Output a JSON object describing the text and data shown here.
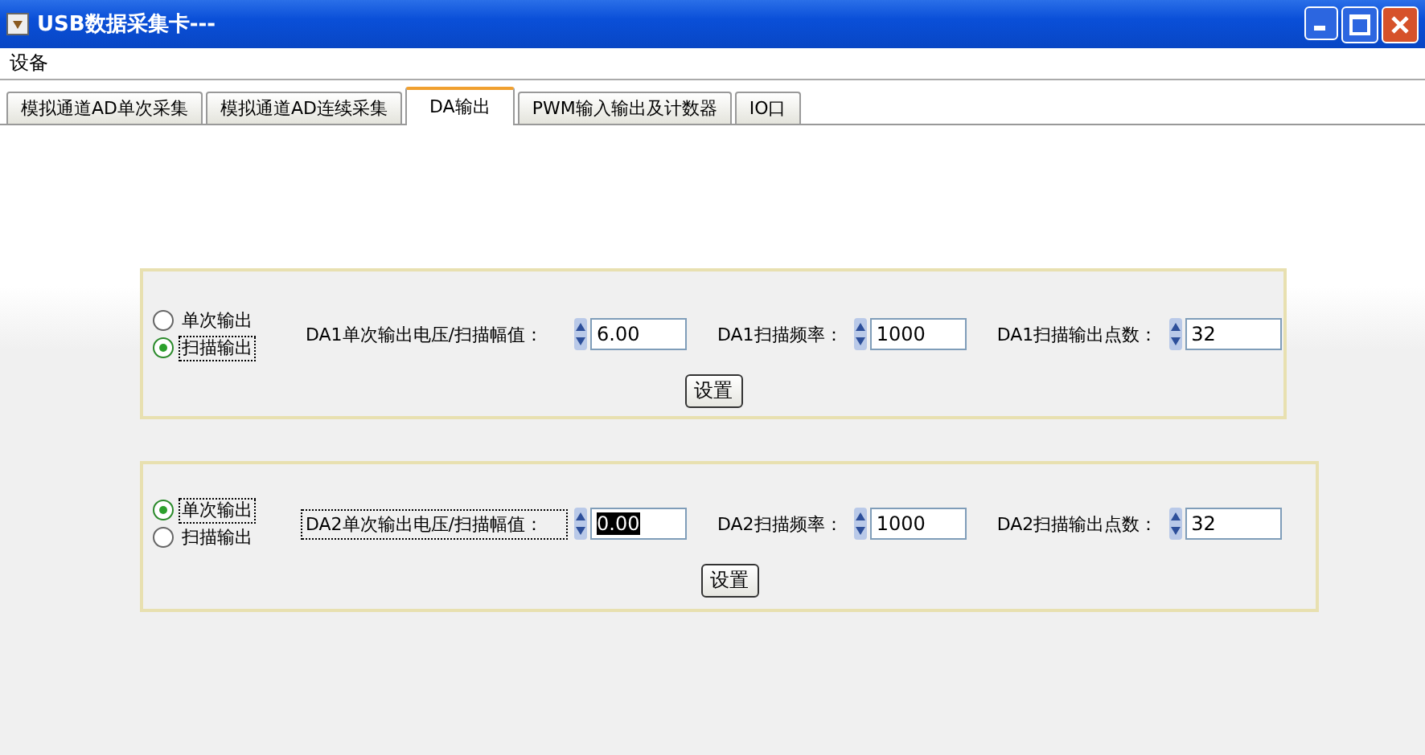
{
  "window": {
    "title": "USB数据采集卡---"
  },
  "menu": [
    "设备"
  ],
  "tabs": [
    {
      "label": "模拟通道AD单次采集",
      "selected": false
    },
    {
      "label": "模拟通道AD连续采集",
      "selected": false
    },
    {
      "label": "DA输出",
      "selected": true
    },
    {
      "label": "PWM输入输出及计数器",
      "selected": false
    },
    {
      "label": "IO口",
      "selected": false
    }
  ],
  "groups": [
    {
      "options": [
        {
          "label": "单次输出",
          "selected": false,
          "focused": false
        },
        {
          "label": "扫描输出",
          "selected": true,
          "focused": true
        }
      ],
      "fields": [
        {
          "label": "DA1单次输出电压/扫描幅值：",
          "value": "6.00",
          "label_focused": false,
          "value_selected": false
        },
        {
          "label": "DA1扫描频率：",
          "value": "1000",
          "label_focused": false,
          "value_selected": false
        },
        {
          "label": "DA1扫描输出点数：",
          "value": "32",
          "label_focused": false,
          "value_selected": false
        }
      ],
      "button": "设置"
    },
    {
      "options": [
        {
          "label": "单次输出",
          "selected": true,
          "focused": true
        },
        {
          "label": "扫描输出",
          "selected": false,
          "focused": false
        }
      ],
      "fields": [
        {
          "label": "DA2单次输出电压/扫描幅值：",
          "value": "0.00",
          "label_focused": true,
          "value_selected": true
        },
        {
          "label": "DA2扫描频率：",
          "value": "1000",
          "label_focused": false,
          "value_selected": false
        },
        {
          "label": "DA2扫描输出点数：",
          "value": "32",
          "label_focused": false,
          "value_selected": false
        }
      ],
      "button": "设置"
    }
  ]
}
